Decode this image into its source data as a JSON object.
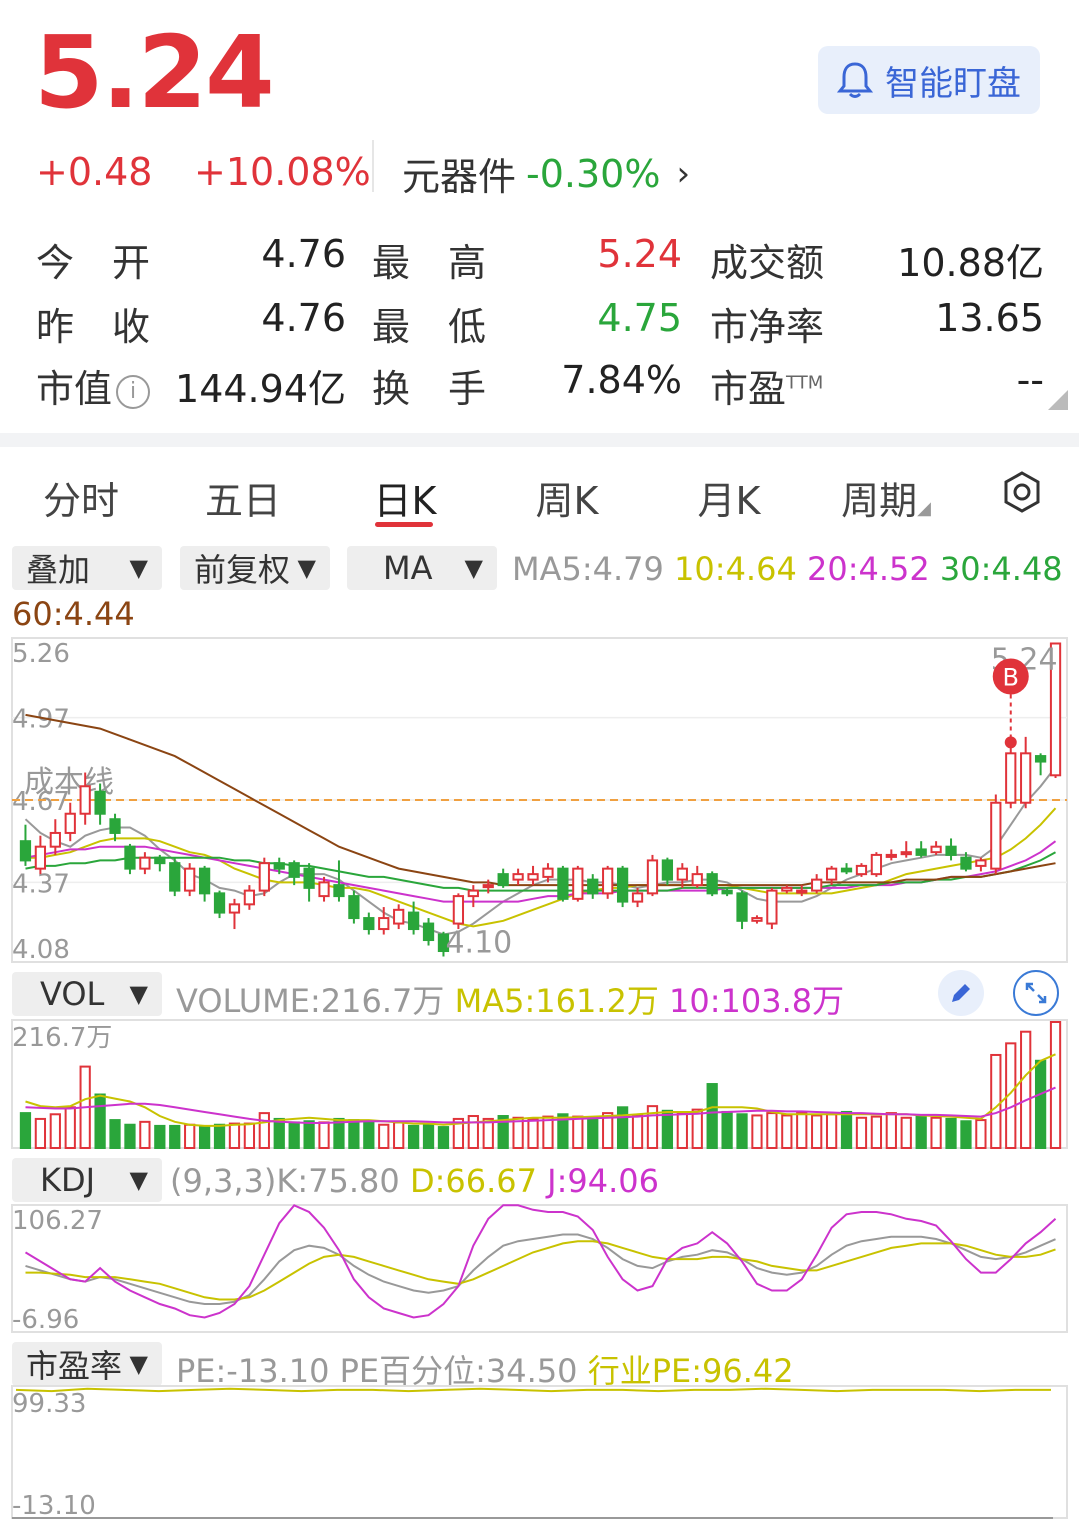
{
  "quote": {
    "price": "5.24",
    "change": "+0.48",
    "change_pct": "+10.08%",
    "sector_name": "元器件",
    "sector_pct": "-0.30%",
    "watch_label": "智能盯盘"
  },
  "stats": [
    {
      "label": "今　开",
      "value": "4.76",
      "color": "default"
    },
    {
      "label": "最　高",
      "value": "5.24",
      "color": "red"
    },
    {
      "label": "成交额",
      "value": "10.88亿",
      "color": "default"
    },
    {
      "label": "昨　收",
      "value": "4.76",
      "color": "default"
    },
    {
      "label": "最　低",
      "value": "4.75",
      "color": "green"
    },
    {
      "label": "市净率",
      "value": "13.65",
      "color": "default"
    },
    {
      "label": "市值",
      "value": "144.94亿",
      "color": "default"
    },
    {
      "label": "换　手",
      "value": "7.84%",
      "color": "default"
    },
    {
      "label": "市盈",
      "value": "--",
      "color": "default"
    }
  ],
  "ttm": "TTM",
  "info_icon": "i",
  "tabs": [
    "分时",
    "五日",
    "日K",
    "周K",
    "月K",
    "周期"
  ],
  "active_tab": "日K",
  "controls": {
    "overlay": "叠加",
    "adjust": "前复权",
    "indicator": "MA",
    "vol": "VOL",
    "kdj": "KDJ",
    "pe": "市盈率"
  },
  "ma_legend": {
    "ma5": "MA5:4.79",
    "ma10": "10:4.64",
    "ma20": "20:4.52",
    "ma30": "30:4.48",
    "ma60": "60:4.44"
  },
  "vol_legend": {
    "volume": "VOLUME:216.7万",
    "ma5": "MA5:161.2万",
    "ma10": "10:103.8万"
  },
  "kdj_legend": {
    "params": "(9,3,3)",
    "k": "K:75.80",
    "d": "D:66.67",
    "j": "J:94.06"
  },
  "pe_legend": {
    "pe": "PE:-13.10",
    "pct": "PE百分位:34.50",
    "industry": "行业PE:96.42"
  },
  "colors": {
    "red": "#e0333a",
    "green": "#2aa63b",
    "ma5": "#999999",
    "ma10": "#c8c200",
    "ma20": "#cc33cc",
    "ma30": "#2aa63b",
    "ma60": "#8b4513",
    "cost": "#f0a040",
    "accent": "#3a66d6"
  },
  "chart_data": {
    "type": "candlestick",
    "price_axis": {
      "max_label": "5.26",
      "min_label": "4.08",
      "gridlines": [
        "4.97",
        "4.67",
        "4.37"
      ],
      "ylim": [
        4.08,
        5.26
      ]
    },
    "cost_line": {
      "label": "成本线",
      "value": 4.67
    },
    "high_label": "5.24",
    "low_label": "4.10",
    "buy_marker": "B",
    "candles": [
      [
        4.52,
        4.45,
        4.58,
        4.43
      ],
      [
        4.42,
        4.5,
        4.54,
        4.4
      ],
      [
        4.5,
        4.55,
        4.6,
        4.47
      ],
      [
        4.55,
        4.62,
        4.66,
        4.52
      ],
      [
        4.62,
        4.72,
        4.77,
        4.58
      ],
      [
        4.7,
        4.62,
        4.73,
        4.58
      ],
      [
        4.6,
        4.55,
        4.62,
        4.52
      ],
      [
        4.5,
        4.42,
        4.51,
        4.4
      ],
      [
        4.42,
        4.46,
        4.48,
        4.4
      ],
      [
        4.46,
        4.44,
        4.47,
        4.41
      ],
      [
        4.44,
        4.34,
        4.46,
        4.32
      ],
      [
        4.34,
        4.42,
        4.44,
        4.32
      ],
      [
        4.42,
        4.33,
        4.43,
        4.3
      ],
      [
        4.33,
        4.26,
        4.34,
        4.24
      ],
      [
        4.26,
        4.29,
        4.31,
        4.2
      ],
      [
        4.29,
        4.34,
        4.36,
        4.27
      ],
      [
        4.34,
        4.44,
        4.46,
        4.32
      ],
      [
        4.44,
        4.42,
        4.46,
        4.4
      ],
      [
        4.44,
        4.39,
        4.45,
        4.36
      ],
      [
        4.42,
        4.35,
        4.44,
        4.3
      ],
      [
        4.32,
        4.37,
        4.39,
        4.3
      ],
      [
        4.36,
        4.32,
        4.45,
        4.3
      ],
      [
        4.32,
        4.24,
        4.34,
        4.22
      ],
      [
        4.24,
        4.2,
        4.26,
        4.18
      ],
      [
        4.2,
        4.24,
        4.28,
        4.18
      ],
      [
        4.22,
        4.27,
        4.29,
        4.2
      ],
      [
        4.26,
        4.2,
        4.3,
        4.18
      ],
      [
        4.22,
        4.16,
        4.24,
        4.14
      ],
      [
        4.18,
        4.12,
        4.19,
        4.1
      ],
      [
        4.22,
        4.32,
        4.33,
        4.2
      ],
      [
        4.32,
        4.34,
        4.36,
        4.28
      ],
      [
        4.36,
        4.36,
        4.38,
        4.33
      ],
      [
        4.4,
        4.36,
        4.42,
        4.35
      ],
      [
        4.38,
        4.4,
        4.42,
        4.36
      ],
      [
        4.38,
        4.4,
        4.43,
        4.36
      ],
      [
        4.39,
        4.42,
        4.44,
        4.37
      ],
      [
        4.42,
        4.31,
        4.43,
        4.3
      ],
      [
        4.31,
        4.42,
        4.43,
        4.3
      ],
      [
        4.38,
        4.33,
        4.4,
        4.31
      ],
      [
        4.33,
        4.42,
        4.43,
        4.31
      ],
      [
        4.42,
        4.3,
        4.43,
        4.28
      ],
      [
        4.3,
        4.33,
        4.35,
        4.28
      ],
      [
        4.33,
        4.45,
        4.47,
        4.32
      ],
      [
        4.45,
        4.38,
        4.46,
        4.36
      ],
      [
        4.38,
        4.42,
        4.44,
        4.35
      ],
      [
        4.36,
        4.4,
        4.43,
        4.35
      ],
      [
        4.4,
        4.33,
        4.41,
        4.32
      ],
      [
        4.34,
        4.33,
        4.35,
        4.32
      ],
      [
        4.33,
        4.23,
        4.34,
        4.2
      ],
      [
        4.23,
        4.24,
        4.25,
        4.22
      ],
      [
        4.22,
        4.34,
        4.35,
        4.2
      ],
      [
        4.34,
        4.35,
        4.36,
        4.33
      ],
      [
        4.34,
        4.34,
        4.36,
        4.32
      ],
      [
        4.34,
        4.38,
        4.4,
        4.33
      ],
      [
        4.38,
        4.42,
        4.43,
        4.36
      ],
      [
        4.42,
        4.41,
        4.44,
        4.4
      ],
      [
        4.4,
        4.43,
        4.44,
        4.39
      ],
      [
        4.4,
        4.47,
        4.48,
        4.39
      ],
      [
        4.47,
        4.47,
        4.49,
        4.45
      ],
      [
        4.48,
        4.48,
        4.52,
        4.46
      ],
      [
        4.49,
        4.47,
        4.52,
        4.46
      ],
      [
        4.48,
        4.5,
        4.52,
        4.47
      ],
      [
        4.5,
        4.47,
        4.53,
        4.45
      ],
      [
        4.46,
        4.42,
        4.48,
        4.41
      ],
      [
        4.43,
        4.45,
        4.46,
        4.41
      ],
      [
        4.42,
        4.66,
        4.69,
        4.4
      ],
      [
        4.66,
        4.84,
        4.88,
        4.64
      ],
      [
        4.66,
        4.84,
        4.9,
        4.64
      ],
      [
        4.83,
        4.81,
        4.84,
        4.76
      ],
      [
        4.76,
        5.24,
        5.24,
        4.75
      ]
    ],
    "ma": {
      "MA5": [
        4.6,
        4.55,
        4.52,
        4.5,
        4.54,
        4.56,
        4.57,
        4.57,
        4.54,
        4.49,
        4.45,
        4.4,
        4.38,
        4.35,
        4.34,
        4.32,
        4.33,
        4.37,
        4.4,
        4.4,
        4.4,
        4.38,
        4.34,
        4.3,
        4.26,
        4.23,
        4.22,
        4.2,
        4.18,
        4.19,
        4.22,
        4.26,
        4.3,
        4.33,
        4.36,
        4.38,
        4.38,
        4.38,
        4.37,
        4.37,
        4.36,
        4.35,
        4.36,
        4.37,
        4.37,
        4.38,
        4.38,
        4.37,
        4.34,
        4.31,
        4.3,
        4.3,
        4.3,
        4.32,
        4.35,
        4.38,
        4.4,
        4.42,
        4.44,
        4.45,
        4.46,
        4.47,
        4.47,
        4.47,
        4.46,
        4.5,
        4.58,
        4.66,
        4.72,
        4.79
      ],
      "MA10": [
        4.46,
        4.46,
        4.47,
        4.48,
        4.5,
        4.52,
        4.53,
        4.53,
        4.53,
        4.52,
        4.5,
        4.48,
        4.47,
        4.45,
        4.42,
        4.4,
        4.38,
        4.37,
        4.37,
        4.37,
        4.36,
        4.35,
        4.35,
        4.34,
        4.32,
        4.3,
        4.28,
        4.26,
        4.24,
        4.22,
        4.21,
        4.22,
        4.23,
        4.25,
        4.27,
        4.29,
        4.31,
        4.33,
        4.34,
        4.35,
        4.35,
        4.36,
        4.36,
        4.36,
        4.36,
        4.36,
        4.36,
        4.36,
        4.35,
        4.34,
        4.33,
        4.33,
        4.33,
        4.33,
        4.33,
        4.34,
        4.35,
        4.36,
        4.38,
        4.4,
        4.41,
        4.42,
        4.43,
        4.44,
        4.45,
        4.46,
        4.49,
        4.53,
        4.58,
        4.64
      ],
      "MA20": [
        4.46,
        4.47,
        4.48,
        4.49,
        4.49,
        4.5,
        4.5,
        4.5,
        4.5,
        4.49,
        4.48,
        4.47,
        4.46,
        4.45,
        4.44,
        4.43,
        4.42,
        4.41,
        4.4,
        4.39,
        4.38,
        4.37,
        4.36,
        4.35,
        4.34,
        4.33,
        4.32,
        4.31,
        4.3,
        4.3,
        4.3,
        4.3,
        4.3,
        4.3,
        4.31,
        4.32,
        4.32,
        4.33,
        4.33,
        4.33,
        4.34,
        4.34,
        4.34,
        4.34,
        4.34,
        4.34,
        4.34,
        4.35,
        4.35,
        4.35,
        4.35,
        4.35,
        4.35,
        4.35,
        4.35,
        4.35,
        4.36,
        4.36,
        4.36,
        4.37,
        4.37,
        4.38,
        4.39,
        4.39,
        4.4,
        4.41,
        4.43,
        4.45,
        4.48,
        4.52
      ],
      "MA30": [
        4.42,
        4.43,
        4.43,
        4.44,
        4.44,
        4.45,
        4.45,
        4.46,
        4.46,
        4.46,
        4.46,
        4.46,
        4.46,
        4.46,
        4.45,
        4.45,
        4.44,
        4.44,
        4.43,
        4.43,
        4.42,
        4.41,
        4.4,
        4.39,
        4.39,
        4.38,
        4.37,
        4.36,
        4.35,
        4.35,
        4.34,
        4.34,
        4.34,
        4.34,
        4.34,
        4.34,
        4.34,
        4.34,
        4.34,
        4.34,
        4.34,
        4.34,
        4.34,
        4.34,
        4.35,
        4.35,
        4.35,
        4.35,
        4.35,
        4.35,
        4.35,
        4.35,
        4.35,
        4.35,
        4.36,
        4.36,
        4.36,
        4.36,
        4.37,
        4.37,
        4.37,
        4.38,
        4.38,
        4.39,
        4.39,
        4.4,
        4.41,
        4.43,
        4.45,
        4.48
      ],
      "MA60": [
        4.98,
        4.97,
        4.96,
        4.95,
        4.94,
        4.93,
        4.91,
        4.89,
        4.87,
        4.85,
        4.83,
        4.8,
        4.77,
        4.74,
        4.71,
        4.68,
        4.65,
        4.62,
        4.59,
        4.56,
        4.53,
        4.5,
        4.48,
        4.46,
        4.44,
        4.42,
        4.41,
        4.4,
        4.39,
        4.38,
        4.37,
        4.37,
        4.36,
        4.36,
        4.36,
        4.36,
        4.36,
        4.36,
        4.36,
        4.36,
        4.36,
        4.36,
        4.36,
        4.36,
        4.36,
        4.36,
        4.36,
        4.36,
        4.36,
        4.36,
        4.36,
        4.36,
        4.36,
        4.37,
        4.37,
        4.37,
        4.37,
        4.37,
        4.37,
        4.38,
        4.38,
        4.38,
        4.39,
        4.39,
        4.39,
        4.4,
        4.41,
        4.42,
        4.43,
        4.44
      ]
    },
    "volume": {
      "max_label": "216.7万",
      "max": 216.7,
      "values": [
        60,
        50,
        58,
        70,
        140,
        92,
        48,
        40,
        45,
        38,
        38,
        40,
        36,
        40,
        42,
        42,
        60,
        50,
        44,
        46,
        44,
        50,
        48,
        46,
        40,
        44,
        38,
        40,
        36,
        50,
        55,
        50,
        55,
        52,
        50,
        54,
        58,
        54,
        52,
        60,
        70,
        56,
        72,
        64,
        60,
        66,
        110,
        62,
        58,
        56,
        60,
        56,
        60,
        56,
        58,
        62,
        52,
        54,
        60,
        52,
        54,
        52,
        50,
        46,
        48,
        160,
        180,
        200,
        150,
        216.7
      ],
      "ma5": [
        80,
        72,
        70,
        72,
        84,
        90,
        85,
        80,
        70,
        55,
        45,
        40,
        38,
        38,
        40,
        41,
        44,
        48,
        50,
        52,
        50,
        48,
        48,
        48,
        46,
        44,
        42,
        42,
        40,
        42,
        44,
        46,
        48,
        50,
        52,
        52,
        52,
        53,
        54,
        55,
        56,
        58,
        60,
        62,
        62,
        62,
        70,
        70,
        70,
        68,
        62,
        58,
        58,
        58,
        58,
        58,
        58,
        58,
        58,
        58,
        56,
        55,
        54,
        52,
        50,
        70,
        95,
        125,
        150,
        161.2
      ],
      "ma10": [
        70,
        69,
        68,
        68,
        70,
        72,
        74,
        76,
        76,
        74,
        70,
        66,
        62,
        58,
        54,
        50,
        47,
        45,
        44,
        43,
        43,
        44,
        45,
        46,
        46,
        46,
        46,
        45,
        44,
        44,
        44,
        44,
        45,
        46,
        47,
        48,
        49,
        50,
        51,
        52,
        53,
        54,
        56,
        57,
        58,
        59,
        61,
        62,
        63,
        64,
        64,
        63,
        63,
        62,
        61,
        60,
        60,
        59,
        58,
        58,
        57,
        57,
        56,
        55,
        54,
        60,
        70,
        82,
        93,
        103.8
      ]
    },
    "kdj": {
      "max_label": "106.27",
      "min_label": "-6.96",
      "ylim": [
        -6.96,
        106.27
      ],
      "K": [
        52,
        48,
        44,
        40,
        38,
        42,
        40,
        36,
        32,
        28,
        24,
        20,
        18,
        18,
        20,
        26,
        40,
        56,
        66,
        70,
        68,
        62,
        52,
        44,
        38,
        34,
        30,
        28,
        30,
        34,
        48,
        60,
        70,
        74,
        76,
        78,
        80,
        80,
        76,
        68,
        58,
        52,
        50,
        56,
        60,
        62,
        66,
        64,
        58,
        50,
        46,
        44,
        46,
        52,
        62,
        70,
        74,
        76,
        78,
        78,
        78,
        76,
        72,
        66,
        60,
        58,
        60,
        64,
        70,
        75.8
      ],
      "D": [
        46,
        46,
        45,
        44,
        42,
        42,
        42,
        40,
        38,
        36,
        32,
        28,
        24,
        22,
        22,
        24,
        30,
        38,
        46,
        54,
        60,
        62,
        60,
        56,
        52,
        48,
        44,
        40,
        38,
        36,
        40,
        46,
        52,
        58,
        64,
        68,
        72,
        74,
        74,
        72,
        68,
        64,
        60,
        58,
        58,
        58,
        60,
        60,
        58,
        56,
        52,
        50,
        48,
        48,
        52,
        56,
        60,
        64,
        68,
        70,
        72,
        72,
        72,
        70,
        66,
        62,
        60,
        60,
        62,
        66.67
      ],
      "J": [
        64,
        56,
        48,
        40,
        38,
        50,
        38,
        30,
        24,
        18,
        14,
        8,
        6,
        10,
        18,
        34,
        62,
        90,
        106,
        100,
        86,
        66,
        40,
        24,
        14,
        10,
        6,
        8,
        18,
        34,
        70,
        94,
        106,
        106,
        102,
        100,
        100,
        96,
        84,
        60,
        40,
        30,
        34,
        58,
        68,
        72,
        82,
        72,
        56,
        36,
        30,
        30,
        40,
        62,
        86,
        98,
        100,
        100,
        98,
        94,
        92,
        88,
        74,
        58,
        46,
        46,
        58,
        72,
        82,
        94.06
      ]
    },
    "pe": {
      "max_label": "99.33",
      "min_label": "-13.10",
      "ylim": [
        -13.1,
        99.33
      ],
      "pe_values": [
        -13.1,
        -13.1
      ],
      "industry": [
        96,
        95,
        97,
        96,
        95,
        96,
        97,
        96,
        95,
        96,
        96,
        95,
        96,
        97,
        96,
        95,
        96,
        96,
        95,
        96,
        96,
        97,
        96,
        95,
        96,
        96,
        96,
        95,
        96,
        96
      ]
    }
  }
}
